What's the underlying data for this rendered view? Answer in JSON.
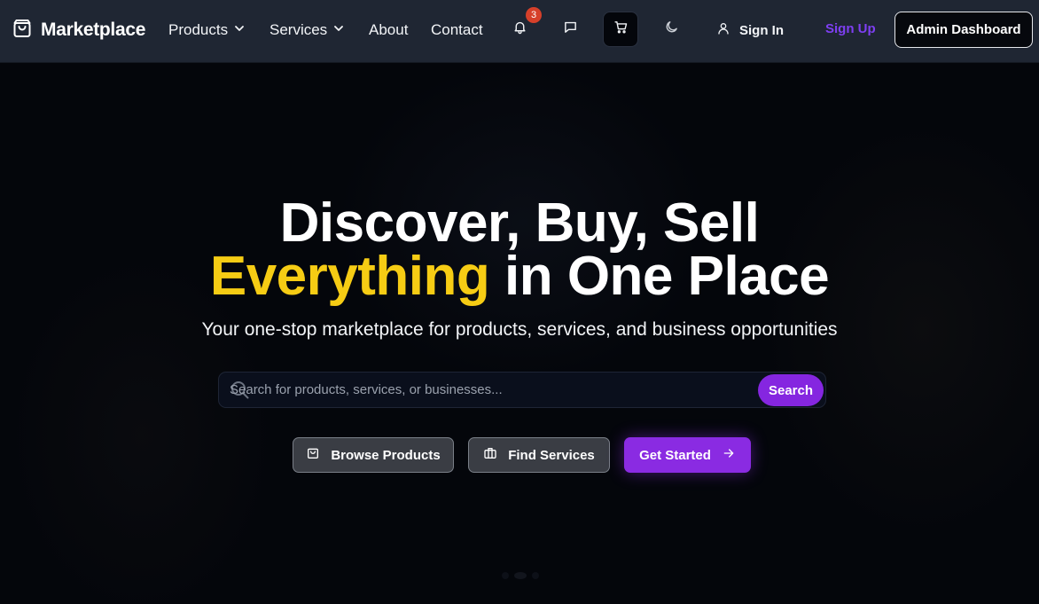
{
  "nav": {
    "brand": "Marketplace",
    "links": [
      {
        "label": "Products",
        "has_dropdown": true
      },
      {
        "label": "Services",
        "has_dropdown": true
      },
      {
        "label": "About"
      },
      {
        "label": "Contact"
      }
    ],
    "notification_count": "3",
    "icons": [
      "shopping-bag-icon",
      "bell-icon",
      "message-icon",
      "cart-icon",
      "moon-icon",
      "user-icon"
    ],
    "sign_in": "Sign In",
    "sign_up": "Sign Up",
    "admin_dashboard": "Admin Dashboard"
  },
  "hero": {
    "headline_line1": "Discover, Buy, Sell",
    "headline_accent": "Everything",
    "headline_rest": " in One Place",
    "subtitle": "Your one-stop marketplace for products, services, and business opportunities",
    "search": {
      "placeholder": "Search for products, services, or businesses...",
      "value": "",
      "button": "Search"
    },
    "buttons": {
      "browse": "Browse Products",
      "services": "Find Services",
      "get_started": "Get Started"
    }
  },
  "colors": {
    "nav_bg": "#1f2633",
    "hero_bg": "#04060b",
    "accent_yellow": "#f6cc14",
    "brand_purple": "#8a2be2",
    "badge_red": "#d6402a"
  }
}
